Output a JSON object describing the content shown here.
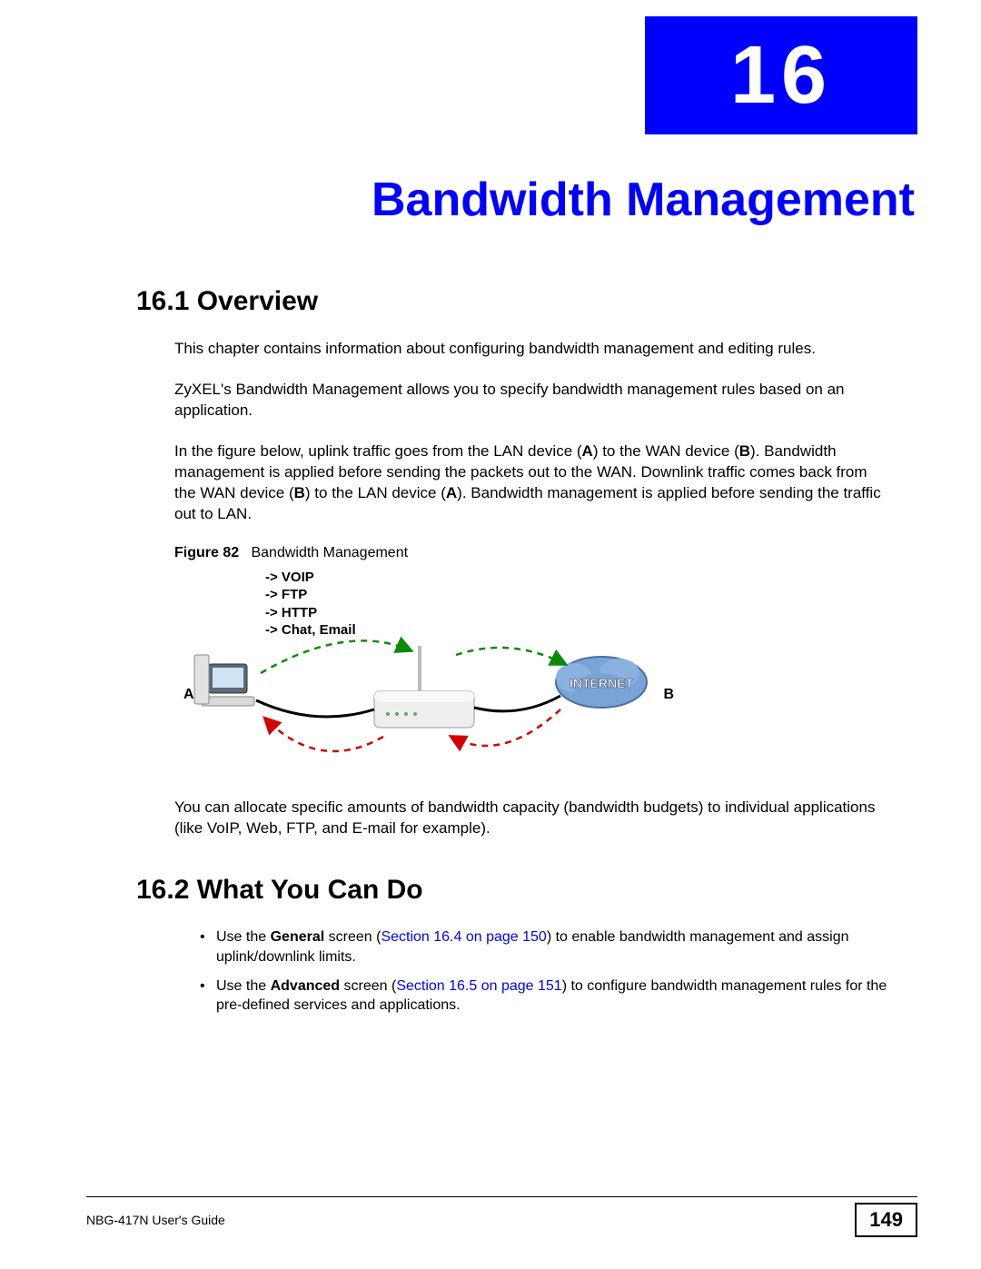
{
  "chapter": {
    "number": "16",
    "title": "Bandwidth Management"
  },
  "section1": {
    "heading": "16.1  Overview",
    "p1": "This chapter contains information about configuring bandwidth management and editing rules.",
    "p2": "ZyXEL's Bandwidth Management allows you to specify bandwidth management rules based on an application.",
    "p3_pre": "In the figure below, uplink traffic goes from the LAN device (",
    "p3_a1": "A",
    "p3_mid1": ") to the WAN device (",
    "p3_b1": "B",
    "p3_mid2": "). Bandwidth management is applied before sending the packets out to the WAN. Downlink traffic comes back from the WAN device (",
    "p3_b2": "B",
    "p3_mid3": ")  to the LAN device (",
    "p3_a2": "A",
    "p3_end": "). Bandwidth management is applied before sending the traffic out to LAN.",
    "p4": "You can allocate specific amounts of bandwidth capacity (bandwidth budgets) to individual applications (like VoIP, Web, FTP, and E-mail for example)."
  },
  "figure": {
    "label": "Figure 82",
    "caption": "Bandwidth Management",
    "protocols": "-> VOIP\n-> FTP\n-> HTTP\n-> Chat, Email",
    "labelA": "A",
    "labelB": "B",
    "internet": "INTERNET"
  },
  "section2": {
    "heading": "16.2  What You Can Do",
    "b1_pre": "Use the ",
    "b1_bold": "General",
    "b1_mid": " screen (",
    "b1_link": "Section 16.4 on page 150",
    "b1_end": ") to enable bandwidth management and assign uplink/downlink limits.",
    "b2_pre": "Use the ",
    "b2_bold": "Advanced",
    "b2_mid": " screen (",
    "b2_link": "Section 16.5 on page 151",
    "b2_end": ") to configure bandwidth management rules for the pre-defined services and applications."
  },
  "footer": {
    "guide": "NBG-417N User's Guide",
    "page": "149"
  }
}
